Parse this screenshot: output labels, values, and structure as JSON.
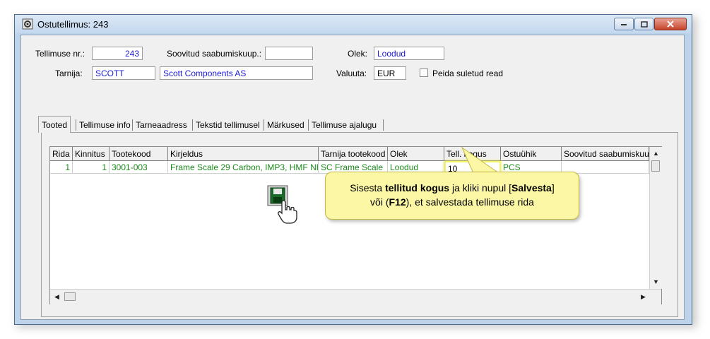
{
  "window": {
    "title": "Ostutellimus: 243",
    "app_icon": "gear-document-icon",
    "controls": {
      "minimize": "minimize-icon",
      "maximize": "maximize-icon",
      "close": "close-icon"
    }
  },
  "header": {
    "order_no_label": "Tellimuse nr.:",
    "order_no_value": "243",
    "desired_arrival_label": "Soovitud saabumiskuup.:",
    "desired_arrival_value": "",
    "status_label": "Olek:",
    "status_value": "Loodud",
    "supplier_label": "Tarnija:",
    "supplier_code": "SCOTT",
    "supplier_name": "Scott Components AS",
    "currency_label": "Valuuta:",
    "currency_value": "EUR",
    "hide_closed_label": "Peida suletud read",
    "hide_closed_checked": false
  },
  "tabs": [
    {
      "label": "Tooted",
      "active": true
    },
    {
      "label": "Tellimuse info",
      "active": false
    },
    {
      "label": "Tarneaadress",
      "active": false
    },
    {
      "label": "Tekstid tellimusel",
      "active": false
    },
    {
      "label": "Märkused",
      "active": false
    },
    {
      "label": "Tellimuse ajalugu",
      "active": false
    }
  ],
  "grid": {
    "columns": [
      "Rida",
      "Kinnitus",
      "Tootekood",
      "Kirjeldus",
      "Tarnija tootekood",
      "Olek",
      "Tell. kogus",
      "Ostuühik",
      "Soovitud saabumiskuu"
    ],
    "rows": [
      [
        "1",
        "1",
        "3001-003",
        "Frame Scale 29 Carbon, IMP3, HMF NE",
        "SC Frame Scale",
        "Loodud",
        "10",
        "PCS",
        ""
      ]
    ]
  },
  "callout": {
    "t1": "Sisesta ",
    "t2": "tellitud kogus",
    "t3": " ja kliki nupul [",
    "t4": "Salvesta",
    "t5": "]",
    "t6": "või (",
    "t7": "F12",
    "t8": "), et salvestada tellimuse rida"
  },
  "icons": {
    "save": "save-icon",
    "cursor": "hand-cursor-icon"
  },
  "colors": {
    "value_blue": "#1a1ad6",
    "row_green": "#1a8a1a",
    "callout_bg": "#fbf7a5",
    "title_bar": "#c4d8ee"
  }
}
